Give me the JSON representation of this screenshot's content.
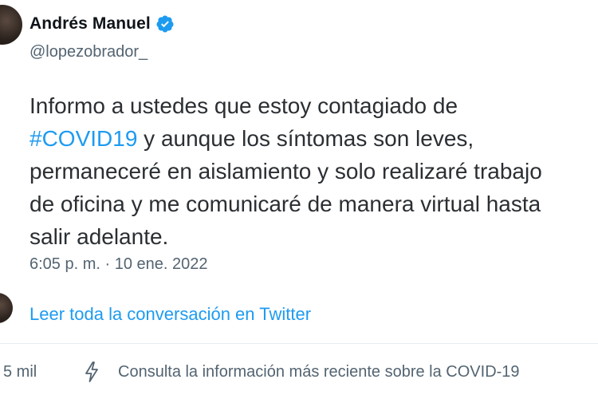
{
  "tweet": {
    "author_name": "Andrés Manuel",
    "handle": "@lopezobrador_",
    "text_lines": [
      {
        "before": "Informo a ustedes que estoy contagiado de",
        "hashtag": "",
        "after": ""
      },
      {
        "before": "",
        "hashtag": "#COVID19",
        "after": " y aunque los síntomas son leves,"
      },
      {
        "before": "permaneceré en aislamiento y solo realizaré trabajo",
        "hashtag": "",
        "after": ""
      },
      {
        "before": "de oficina y me comunicaré de manera virtual hasta",
        "hashtag": "",
        "after": ""
      },
      {
        "before": "salir adelante.",
        "hashtag": "",
        "after": ""
      }
    ],
    "timestamp": "6:05 p. m. · 10 ene. 2022",
    "read_more": "Leer toda la conversación en Twitter"
  },
  "footer": {
    "like_count": "5 mil",
    "info_text": "Consulta la información más reciente sobre la COVID-19"
  },
  "icons": {
    "verified": "verified-badge-icon",
    "bolt": "lightning-bolt-icon"
  },
  "colors": {
    "link": "#1d9bf0",
    "muted": "#536471",
    "text": "#2b2f33"
  }
}
